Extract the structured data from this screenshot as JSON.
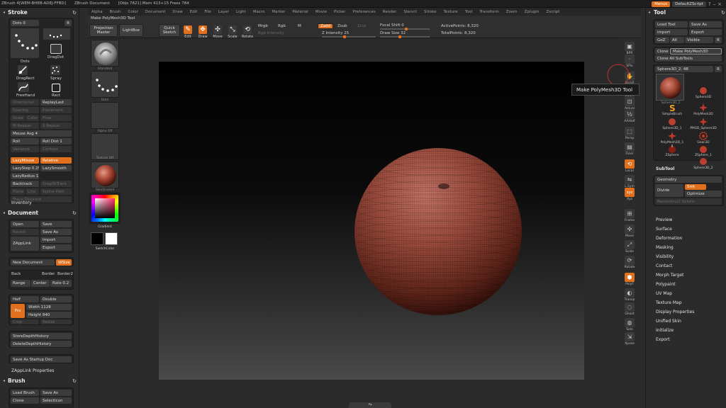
{
  "titlebar": {
    "app": "ZBrush 4[WEM-BHEB-ADEJ-FFBD]",
    "doc": "ZBrush Document",
    "objs": "[Objs 7821] Mem 413+15 Frees 784",
    "menus_label": "Menus",
    "script_label": "DefaultZScript"
  },
  "menus": [
    "Alpha",
    "Brush",
    "Color",
    "Document",
    "Draw",
    "Edit",
    "File",
    "Layer",
    "Light",
    "Macro",
    "Marker",
    "Material",
    "Movie",
    "Picker",
    "Preferences",
    "Render",
    "Stencil",
    "Stroke",
    "Texture",
    "Tool",
    "Transform",
    "Zoom",
    "Zplugin",
    "Zscript"
  ],
  "toolbar": {
    "make_polymesh": "Make PolyMesh3D Tool",
    "projection_master": "Projection Master",
    "lightbox": "LightBox",
    "quick_sketch": "Quick Sketch",
    "edit": "Edit",
    "draw": "Draw",
    "move": "Move",
    "scale": "Scale",
    "rotate": "Rotate",
    "mrgb": "Mrgb",
    "rgb": "Rgb",
    "m": "M",
    "rgb_intensity": "Rgb Intensity",
    "zadd": "Zadd",
    "zsub": "Zsub",
    "zcut": "Zcut",
    "z_intensity": "Z Intensity 25",
    "focal_shift": "Focal Shift 0",
    "draw_size": "Draw Size 32",
    "active_points": "ActivePoints: 8,320",
    "total_points": "TotalPoints: 8,320"
  },
  "left": {
    "stroke_title": "Stroke",
    "dots_label": "Dots 0",
    "r": "R",
    "dots": "Dots",
    "dragdot": "DragDot",
    "dragrect": "DragRect",
    "spray": "Spray",
    "freehand": "FreeHand",
    "rect": "Rect",
    "directional": "Directional",
    "replaylast": "ReplayLast",
    "spacing": "Spacing",
    "placement": "Placement",
    "scale_stroke": "Scale",
    "color": "Color",
    "flow": "Flow",
    "m_repeat": "M Repeat",
    "s_repeat": "S Repeat",
    "mouse_avg": "Mouse Avg 4",
    "roll": "Roll",
    "roll_dist": "Roll Dist 1",
    "variance": "Variance",
    "contour": "Contour",
    "lazymouse": "LazyMouse",
    "relative": "Relative",
    "lazystep": "LazyStep 0.25",
    "lazysmooth": "LazySmooth",
    "lazyradius": "LazyRadius 1",
    "backtrack": "Backtrack",
    "plane": "Plane",
    "spline_path": "Spline Path",
    "snap_to_track": "SnapToTrack",
    "curve": "Curve",
    "line": "Line",
    "trace_distance": "Trace Distance",
    "inventory": "Inventory",
    "document_title": "Document",
    "open": "Open",
    "save": "Save",
    "revert": "Revert",
    "save_as": "Save As",
    "zapplink": "ZAppLink",
    "import": "Import",
    "export": "Export",
    "new_document": "New Document",
    "wsize": "WSize",
    "back": "Back",
    "border": "Border",
    "border2": "Border2",
    "range": "Range",
    "center": "Center",
    "rate": "Rate 0.2",
    "half": "Half",
    "double": "Double",
    "pro": "Pro",
    "width": "Width 1128",
    "height": "Height 840",
    "crop": "Crop",
    "resize": "Resize",
    "store_depth": "StoreDepthHistory",
    "delete_depth": "DeleteDepthHistory",
    "save_startup": "Save As Startup Doc",
    "zapplink_props": "ZAppLink Properties",
    "brush_title": "Brush",
    "load_brush": "Load Brush",
    "brush_save_as": "Save As",
    "clone": "Clone",
    "selecticon": "SelectIcon"
  },
  "strip": {
    "standard": "Standard",
    "dots": "Dots",
    "alpha_off": "Alpha Off",
    "texture_off": "Texture Off",
    "material": "SkinShade4",
    "gradient": "Gradient",
    "switchcolor": "SwitchColor"
  },
  "shelf": {
    "bpr": "BPR",
    "spix": "SPix",
    "scroll": "Scroll",
    "zoom": "Zoom",
    "actual": "Actual",
    "aahalf": "AAHalf",
    "persp": "Persp",
    "floor": "Floor",
    "local": "Local",
    "l_sym": "L.Sym",
    "xyz": "Xyz",
    "frame": "Frame",
    "move": "Move",
    "scale": "Scale",
    "rotate": "Rotate",
    "polyf": "PolyF",
    "transp": "Transp",
    "ghost": "Ghost",
    "solo": "Solo",
    "xpose": "Xpose"
  },
  "right": {
    "tool_title": "Tool",
    "load_tool": "Load Tool",
    "save_as": "Save As",
    "import": "Import",
    "export": "Export",
    "goz": "GoZ",
    "all": "All",
    "visible": "Visible",
    "r": "R",
    "clone": "Clone",
    "make_polymesh": "Make PolyMesh3D",
    "clone_all": "Clone All SubTools",
    "sphere3d_label": "Sphere3D_2. 48",
    "subtools": [
      {
        "label": "Sphere3D_2",
        "kind": "sphere"
      },
      {
        "label": "Sphere3D",
        "kind": "ball"
      },
      {
        "label": "SimpleBrush",
        "kind": "s"
      },
      {
        "label": "PolyMesh3D",
        "kind": "star"
      },
      {
        "label": "Sphere3D_1",
        "kind": "ball"
      },
      {
        "label": "PM3D_Sphere3D",
        "kind": "star"
      },
      {
        "label": "PolyMesh3D_1",
        "kind": "star"
      },
      {
        "label": "Gear3D",
        "kind": "gear"
      },
      {
        "label": "ZSphere",
        "kind": "zsphere"
      },
      {
        "label": "ZSphere_1",
        "kind": "zsphere-red"
      },
      {
        "label": "Sphere3D_2",
        "kind": "ball"
      }
    ],
    "subtool_menu": "SubTool",
    "geometry": "Geometry",
    "divide": "Divide",
    "smt": "Smt",
    "optimize": "Optimize",
    "sdiv": "Sdiv",
    "lower_res": "Lower Res",
    "higher_res": "Higher Res",
    "reconstruct": "Reconstruct Subdiv",
    "sections": [
      "Preview",
      "Surface",
      "Deformation",
      "Masking",
      "Visibility",
      "Contact",
      "Morph Target",
      "Polypaint",
      "UV Map",
      "Texture Map",
      "Display Properties",
      "Unified Skin",
      "Initialize",
      "Export"
    ]
  },
  "tooltip": "Make PolyMesh3D Tool",
  "bottom_tab": "▾▴"
}
